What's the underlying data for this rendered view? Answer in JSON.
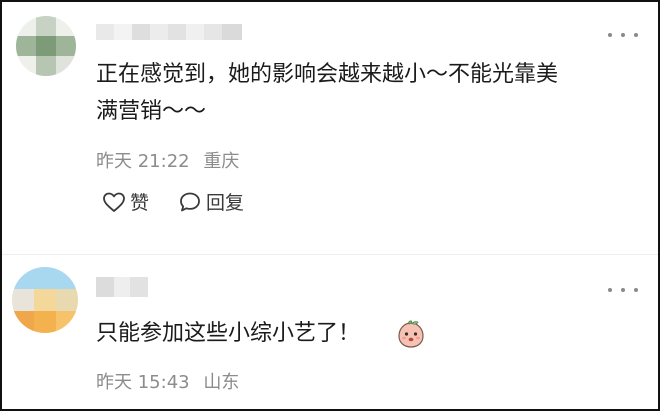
{
  "comments": [
    {
      "text_line1": "正在感觉到，她的影响会越来越小～不能光靠美",
      "text_line2": "满营销～～",
      "time": "昨天 21:22",
      "location": "重庆",
      "like_label": "赞",
      "reply_label": "回复",
      "avatar_colors": [
        "#dfe3dc",
        "#9fb59a",
        "#c8d2c4",
        "#eef0ec"
      ]
    },
    {
      "text": "只能参加这些小综小艺了！",
      "time": "昨天 15:43",
      "location": "山东",
      "avatar_colors": [
        "#9dd3ef",
        "#f1c97a",
        "#f0a64a",
        "#e8e4da"
      ]
    }
  ],
  "icons": {
    "more": "more-dots-icon",
    "like": "heart-outline-icon",
    "reply": "speech-bubble-icon",
    "emoji": "peach-face-emoji-icon"
  }
}
